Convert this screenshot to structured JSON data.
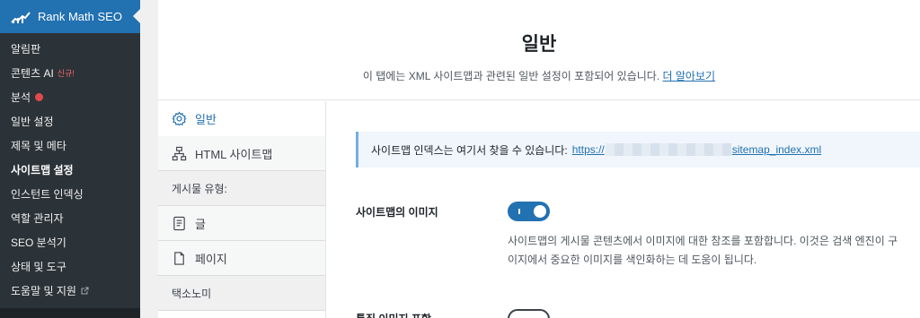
{
  "sidebar": {
    "title": "Rank Math SEO",
    "items": [
      {
        "label": "알림판"
      },
      {
        "label": "콘텐츠 AI",
        "badge": "신규!"
      },
      {
        "label": "분석",
        "dot_color": "#e24a4a"
      },
      {
        "label": "일반 설정"
      },
      {
        "label": "제목 및 메타"
      },
      {
        "label": "사이트맵 설정",
        "current": true
      },
      {
        "label": "인스턴트 인덱싱"
      },
      {
        "label": "역할 관리자"
      },
      {
        "label": "SEO 분석기"
      },
      {
        "label": "상태 및 도구"
      },
      {
        "label": "도움말 및 지원",
        "icon": "external-link-icon"
      }
    ]
  },
  "header": {
    "title": "일반",
    "description": "이 탭에는 XML 사이트맵과 관련된 일반 설정이 포함되어 있습니다.",
    "learn_more": "더 알아보기"
  },
  "tabs": {
    "general": "일반",
    "html_sitemap": "HTML 사이트맵",
    "post_types_group": "게시물 유형:",
    "post": "글",
    "page": "페이지",
    "taxonomy_group": "택소노미"
  },
  "notice": {
    "text": "사이트맵 인덱스는 여기서 찾을 수 있습니다:",
    "url_start": "https://",
    "url_end": "sitemap_index.xml"
  },
  "settings": {
    "images_label": "사이트맵의 이미지",
    "images_enabled": true,
    "images_desc_line1": "사이트맵의 게시물 콘텐츠에서 이미지에 대한 참조를 포함합니다. 이것은 검색 엔진이 구",
    "images_desc_line2": "이지에서 중요한 이미지를 색인화하는 데 도움이 됩니다.",
    "featured_label": "특집 이미지 포함",
    "featured_enabled": false
  },
  "colors": {
    "accent": "#2271b1",
    "sidebar_bg": "#1d2327",
    "submenu_bg": "#2c3338"
  }
}
